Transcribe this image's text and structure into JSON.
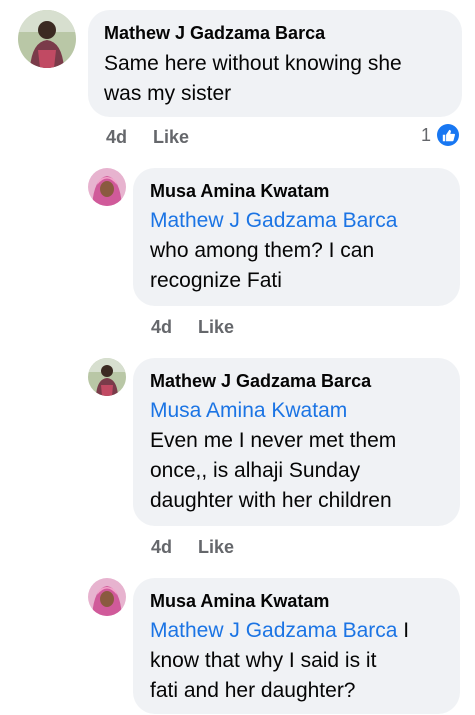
{
  "comments": [
    {
      "author": "Mathew J Gadzama Barca",
      "mention": "",
      "text_line1": "Same here without knowing she",
      "text_line2": "was my sister",
      "time": "4d",
      "like": "Like",
      "reaction_count": "1"
    },
    {
      "author": "Musa Amina Kwatam",
      "mention": "Mathew J Gadzama Barca",
      "text_line1": "who among them? I can",
      "text_line2": "recognize Fati",
      "time": "4d",
      "like": "Like"
    },
    {
      "author": "Mathew J Gadzama Barca",
      "mention": "Musa Amina Kwatam",
      "text_line1": "Even me I never met them",
      "text_line2": "once,, is alhaji Sunday",
      "text_line3": "daughter with her children",
      "time": "4d",
      "like": "Like"
    },
    {
      "author": "Musa Amina Kwatam",
      "mention": "Mathew J Gadzama Barca",
      "mention_suffix": " I",
      "text_line1": "know that why I said is it",
      "text_line2": "fati and her daughter?"
    }
  ],
  "colors": {
    "bubble": "#f0f2f5",
    "mention": "#1b74e4",
    "meta": "#65676b",
    "like_icon": "#1877f2"
  },
  "icons": {
    "reaction": "thumbs-up-icon"
  }
}
